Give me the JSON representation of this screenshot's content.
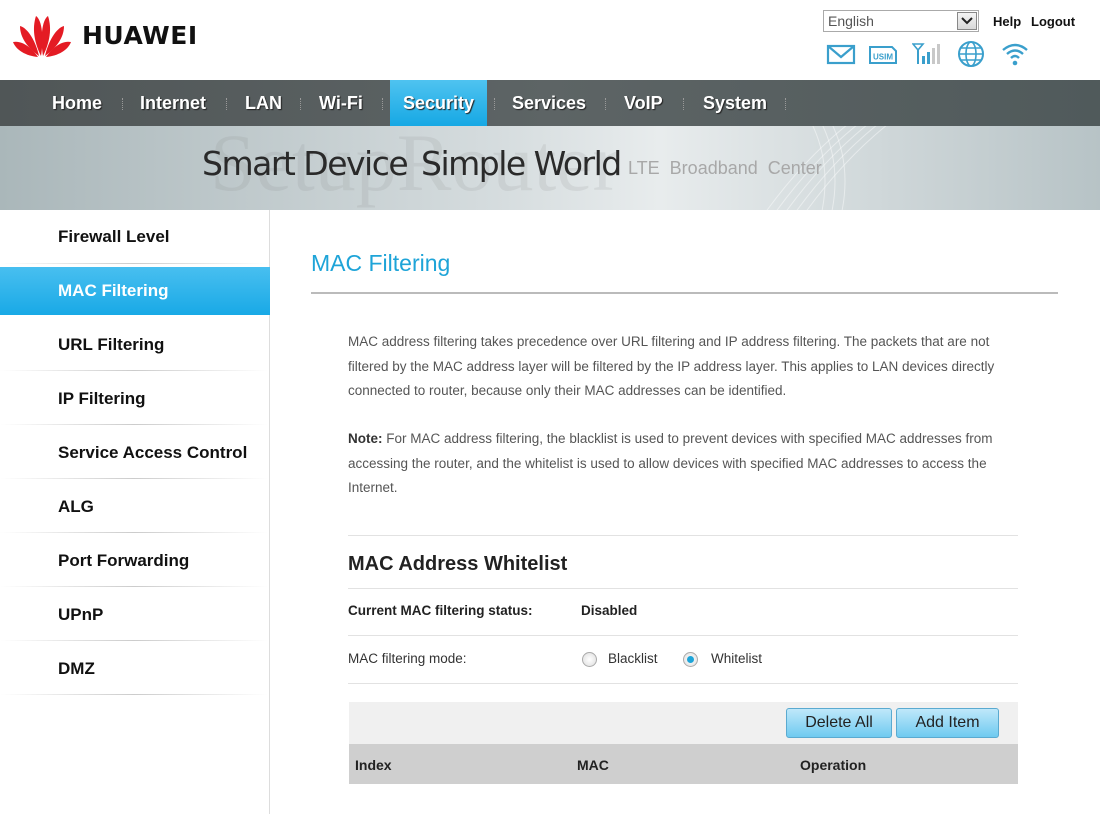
{
  "brand": {
    "name": "HUAWEI",
    "logo_color": "#e41b24"
  },
  "header": {
    "language": "English",
    "help": "Help",
    "logout": "Logout",
    "status_icons": [
      "mail-icon",
      "usim-icon",
      "signal-icon",
      "globe-icon",
      "wifi-icon"
    ],
    "usim_label": "USIM"
  },
  "nav": {
    "items": [
      {
        "label": "Home",
        "active": false
      },
      {
        "label": "Internet",
        "active": false
      },
      {
        "label": "LAN",
        "active": false
      },
      {
        "label": "Wi-Fi",
        "active": false
      },
      {
        "label": "Security",
        "active": true
      },
      {
        "label": "Services",
        "active": false
      },
      {
        "label": "VoIP",
        "active": false
      },
      {
        "label": "System",
        "active": false
      }
    ],
    "accent": "#1ea4d8"
  },
  "banner": {
    "slogan_1": "Smart Device",
    "slogan_2": "Simple World",
    "subtitle": "LTE  Broadband  Center",
    "watermark": "SetupRouter"
  },
  "sidebar": {
    "items": [
      {
        "label": "Firewall Level",
        "active": false
      },
      {
        "label": "MAC Filtering",
        "active": true
      },
      {
        "label": "URL Filtering",
        "active": false
      },
      {
        "label": "IP Filtering",
        "active": false
      },
      {
        "label": "Service Access Control",
        "active": false
      },
      {
        "label": "ALG",
        "active": false
      },
      {
        "label": "Port Forwarding",
        "active": false
      },
      {
        "label": "UPnP",
        "active": false
      },
      {
        "label": "DMZ",
        "active": false
      }
    ]
  },
  "main": {
    "title": "MAC Filtering",
    "description": "MAC address filtering takes precedence over URL filtering and IP address filtering. The packets that are not filtered by the MAC address layer will be filtered by the IP address layer. This applies to LAN devices directly connected to router, because only their MAC addresses can be identified.",
    "note_label": "Note:",
    "note_text": " For MAC address filtering, the blacklist is used to prevent devices with specified MAC addresses from accessing the router, and the whitelist is used to allow devices with specified MAC addresses to access the Internet.",
    "section_title": "MAC Address Whitelist",
    "status_label": "Current MAC filtering status:",
    "status_value": "Disabled",
    "mode_label": "MAC filtering mode:",
    "mode_options": [
      {
        "label": "Blacklist",
        "checked": false
      },
      {
        "label": "Whitelist",
        "checked": true
      }
    ],
    "buttons": {
      "delete_all": "Delete All",
      "add_item": "Add Item"
    },
    "table": {
      "columns": [
        "Index",
        "MAC",
        "Operation"
      ],
      "rows": []
    }
  }
}
